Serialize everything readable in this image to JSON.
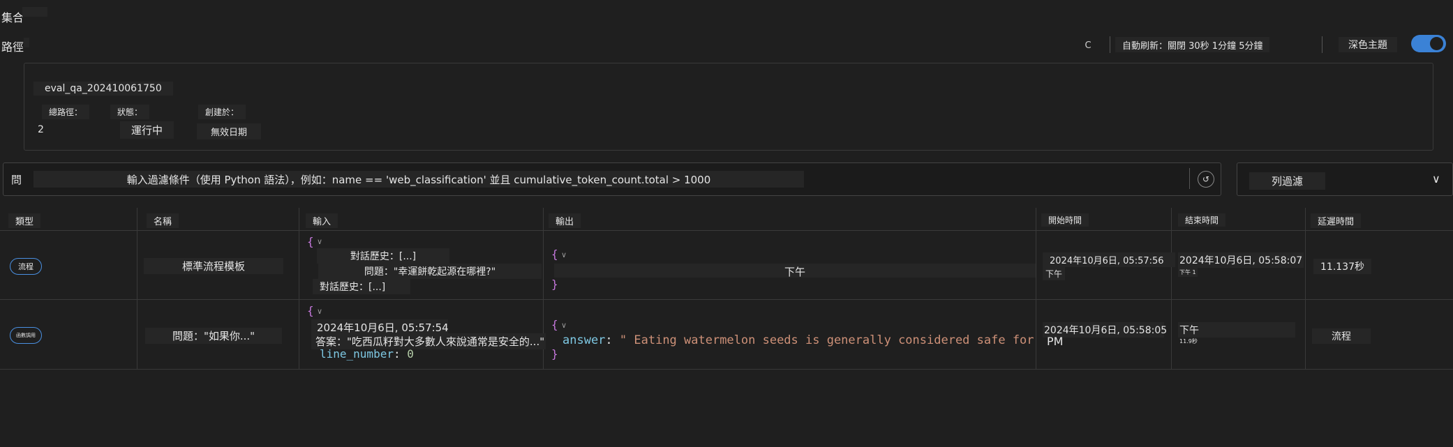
{
  "header": {
    "title": "集合",
    "path_label": "路徑"
  },
  "toolbar": {
    "refresh_icon_glyph": "C",
    "auto_refresh": "自動刷新：關閉 30秒 1分鐘 5分鐘",
    "dark_theme_label": "深色主題",
    "dark_theme_on": true
  },
  "run": {
    "name": "eval_qa_202410061750",
    "total_paths_label": "總路徑：",
    "total_paths": "2",
    "status_label": "狀態：",
    "status": "運行中",
    "created_label": "創建於：",
    "created": "無效日期"
  },
  "filter": {
    "prefix": "問",
    "placeholder": "輸入過濾條件（使用 Python 語法），例如：name == 'web_classification' 並且 cumulative_token_count.total > 1000",
    "column_filter_label": "列過濾",
    "chevron": "∨"
  },
  "table": {
    "headers": {
      "type": "類型",
      "name": "名稱",
      "input": "輸入",
      "output": "輸出",
      "start": "開始時間",
      "end": "結束時間",
      "latency": "延遲時間"
    },
    "header_marker": "!",
    "rows": [
      {
        "type": "流程",
        "name": "標準流程模板",
        "input_line1": "對話歷史：[...]",
        "input_line2": "問題：\"幸運餅乾起源在哪裡?\"",
        "input_line3": "對話歷史：[...]",
        "output_text": "下午",
        "start": "2024年10月6日, 05:57:56",
        "start_suffix": "下午",
        "end": "2024年10月6日, 05:58:07",
        "end_small": "下午 1",
        "latency": "11.137秒"
      },
      {
        "type": "函數調用",
        "name": "問題：\"如果你...\"",
        "input_line1": "2024年10月6日, 05:57:54",
        "input_line2": "答案：\"吃西瓜籽對大多數人來說通常是安全的...\"",
        "input_key3": "line_number",
        "input_val3": "0",
        "output_key": "answer",
        "output_val": "\" Eating watermelon seeds is generally considered safe for most",
        "start": "2024年10月6日, 05:58:05",
        "start_suffix": "PM",
        "end": "下午",
        "end_small": "11.9秒",
        "latency": "流程"
      }
    ]
  }
}
